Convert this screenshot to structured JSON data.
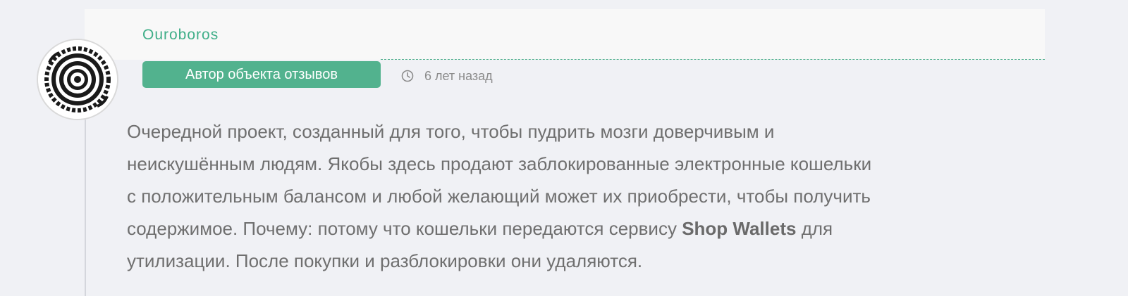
{
  "comment": {
    "author": "Ouroboros",
    "badge": "Автор объекта отзывов",
    "time_ago": "6 лет назад",
    "time_icon": "clock-icon",
    "avatar_icon": "ouroboros-avatar",
    "text": {
      "line1": "Очередной проект, созданный для того, чтобы пудрить мозги доверчивым и",
      "line2": "неискушённым людям. Якобы здесь продают заблокированные электронные кошельки",
      "line3": "с положительным балансом и любой желающий может их приобрести, чтобы получить",
      "line4_before": "содержимое. Почему: потому что кошельки передаются сервису ",
      "line4_bold": "Shop Wallets",
      "line4_after": " для",
      "line5": "утилизации. После покупки и разблокировки они удаляются."
    }
  },
  "colors": {
    "background": "#f0f1f5",
    "header_band": "#f8f8f8",
    "accent": "#52b28e",
    "author_name": "#3fae88",
    "body_text": "#6f6f6f",
    "meta_text": "#8b8b8b"
  }
}
